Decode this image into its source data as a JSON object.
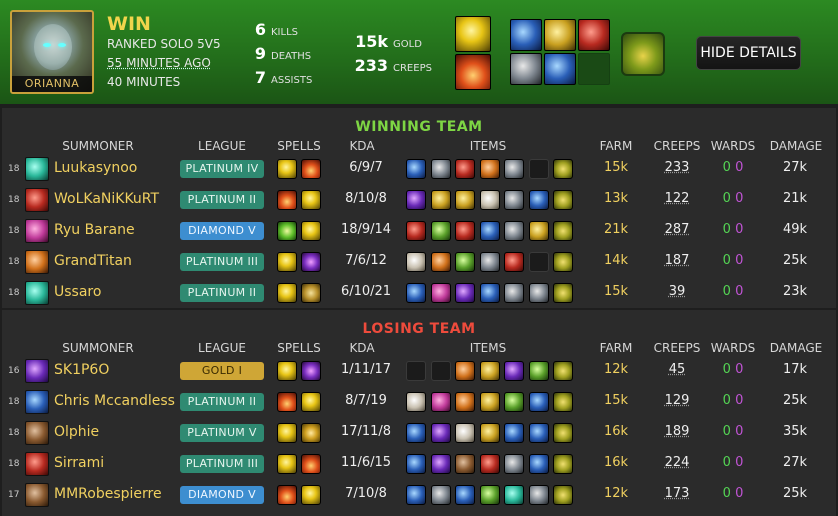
{
  "header": {
    "champion": "ORIANNA",
    "result": "WIN",
    "queue": "RANKED SOLO 5V5",
    "time_ago": "55 MINUTES AGO",
    "duration": "40 MINUTES",
    "kills": "6",
    "kills_label": "KILLS",
    "deaths": "9",
    "deaths_label": "DEATHS",
    "assists": "7",
    "assists_label": "ASSISTS",
    "gold": "15k",
    "gold_label": "GOLD",
    "creeps": "233",
    "creeps_label": "CREEPS",
    "spells": [
      "flash",
      "ignite"
    ],
    "items": [
      "blue",
      "gold",
      "red",
      "steel",
      "blue",
      "empty"
    ],
    "trinket": "ward",
    "hide_details": "HIDE DETAILS"
  },
  "columns": {
    "summoner": "SUMMONER",
    "league": "LEAGUE",
    "spells": "SPELLS",
    "kda": "KDA",
    "items": "ITEMS",
    "farm": "FARM",
    "creeps": "CREEPS",
    "wards": "WARDS",
    "damage": "DAMAGE"
  },
  "winning_team": {
    "title": "WINNING TEAM",
    "players": [
      {
        "level": "18",
        "name": "Luukasynoo",
        "league": "PLATINUM IV",
        "tier": "plat",
        "spells": [
          "flash",
          "ignite"
        ],
        "kda": "6/9/7",
        "items": [
          "blue",
          "steel",
          "red",
          "orange",
          "steel",
          "empty",
          "ward"
        ],
        "farm": "15k",
        "creeps": "233",
        "wards_g": "0",
        "wards_p": "0",
        "damage": "27k",
        "avatar": "teal"
      },
      {
        "level": "18",
        "name": "WoLKaNiKKuRT",
        "league": "PLATINUM II",
        "tier": "plat",
        "spells": [
          "ignite",
          "flash"
        ],
        "kda": "8/10/8",
        "items": [
          "purple",
          "gold",
          "gold",
          "bone",
          "steel",
          "blue",
          "ward"
        ],
        "farm": "13k",
        "creeps": "122",
        "wards_g": "0",
        "wards_p": "0",
        "damage": "21k",
        "avatar": "red"
      },
      {
        "level": "18",
        "name": "Ryu Barane",
        "league": "DIAMOND V",
        "tier": "dia",
        "spells": [
          "heal",
          "flash"
        ],
        "kda": "18/9/14",
        "items": [
          "red",
          "green",
          "red",
          "blue",
          "steel",
          "gold",
          "ward"
        ],
        "farm": "21k",
        "creeps": "287",
        "wards_g": "0",
        "wards_p": "0",
        "damage": "49k",
        "avatar": "pink"
      },
      {
        "level": "18",
        "name": "GrandTitan",
        "league": "PLATINUM III",
        "tier": "plat",
        "spells": [
          "flash",
          "teleport"
        ],
        "kda": "7/6/12",
        "items": [
          "bone",
          "orange",
          "green",
          "steel",
          "red",
          "empty",
          "ward"
        ],
        "farm": "14k",
        "creeps": "187",
        "wards_g": "0",
        "wards_p": "0",
        "damage": "25k",
        "avatar": "orange"
      },
      {
        "level": "18",
        "name": "Ussaro",
        "league": "PLATINUM II",
        "tier": "plat",
        "spells": [
          "flash",
          "exhaust"
        ],
        "kda": "6/10/21",
        "items": [
          "blue",
          "pink",
          "purple",
          "blue",
          "steel",
          "steel",
          "ward"
        ],
        "farm": "15k",
        "creeps": "39",
        "wards_g": "0",
        "wards_p": "0",
        "damage": "23k",
        "avatar": "teal"
      }
    ]
  },
  "losing_team": {
    "title": "LOSING TEAM",
    "players": [
      {
        "level": "16",
        "name": "SK1P6O",
        "league": "GOLD I",
        "tier": "gold",
        "spells": [
          "flash",
          "teleport"
        ],
        "kda": "1/11/17",
        "items": [
          "empty",
          "empty",
          "orange",
          "gold",
          "purple",
          "green",
          "ward"
        ],
        "farm": "12k",
        "creeps": "45",
        "wards_g": "0",
        "wards_p": "0",
        "damage": "17k",
        "avatar": "purple"
      },
      {
        "level": "18",
        "name": "Chris Mccandless",
        "league": "PLATINUM II",
        "tier": "plat",
        "spells": [
          "ignite",
          "flash"
        ],
        "kda": "8/7/19",
        "items": [
          "bone",
          "pink",
          "orange",
          "gold",
          "green",
          "blue",
          "ward"
        ],
        "farm": "15k",
        "creeps": "129",
        "wards_g": "0",
        "wards_p": "0",
        "damage": "25k",
        "avatar": "blue"
      },
      {
        "level": "18",
        "name": "Olphie",
        "league": "PLATINUM V",
        "tier": "plat",
        "spells": [
          "flash",
          "barrier"
        ],
        "kda": "17/11/8",
        "items": [
          "blue",
          "purple",
          "bone",
          "gold",
          "blue",
          "blue",
          "ward"
        ],
        "farm": "16k",
        "creeps": "189",
        "wards_g": "0",
        "wards_p": "0",
        "damage": "35k",
        "avatar": "brown"
      },
      {
        "level": "18",
        "name": "Sirrami",
        "league": "PLATINUM III",
        "tier": "plat",
        "spells": [
          "flash",
          "ignite"
        ],
        "kda": "11/6/15",
        "items": [
          "blue",
          "purple",
          "brown",
          "red",
          "steel",
          "blue",
          "ward"
        ],
        "farm": "16k",
        "creeps": "224",
        "wards_g": "0",
        "wards_p": "0",
        "damage": "27k",
        "avatar": "red"
      },
      {
        "level": "17",
        "name": "MMRobespierre",
        "league": "DIAMOND V",
        "tier": "dia",
        "spells": [
          "ignite",
          "flash"
        ],
        "kda": "7/10/8",
        "items": [
          "blue",
          "steel",
          "blue",
          "green",
          "teal",
          "steel",
          "ward"
        ],
        "farm": "12k",
        "creeps": "173",
        "wards_g": "0",
        "wards_p": "0",
        "damage": "25k",
        "avatar": "brown"
      }
    ]
  }
}
